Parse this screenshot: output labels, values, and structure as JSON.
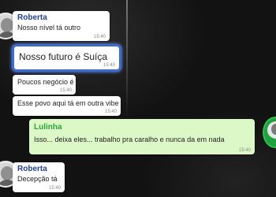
{
  "messages": [
    {
      "sender": "Roberta",
      "text": "Nosso nível tá outro",
      "time": "15:40"
    },
    {
      "text": "Nosso futuro é Suíça",
      "time": "15:40"
    },
    {
      "text": "Poucos negócio é bom",
      "time": "15:40"
    },
    {
      "text": "Esse povo aqui tá em outra vibe",
      "time": "15:40"
    },
    {
      "sender": "Lulinha",
      "text": "Isso... deixa eles... trabalho pra caralho e nunca da em nada",
      "time": "15:40"
    },
    {
      "sender": "Roberta",
      "text": "Decepção tá",
      "time": "15:40"
    }
  ],
  "colors": {
    "roberta_name": "#1f3fa8",
    "lulinha_name": "#2aa838",
    "highlight_border": "#3a6bd8",
    "outgoing_bubble": "#dcf8c6"
  }
}
